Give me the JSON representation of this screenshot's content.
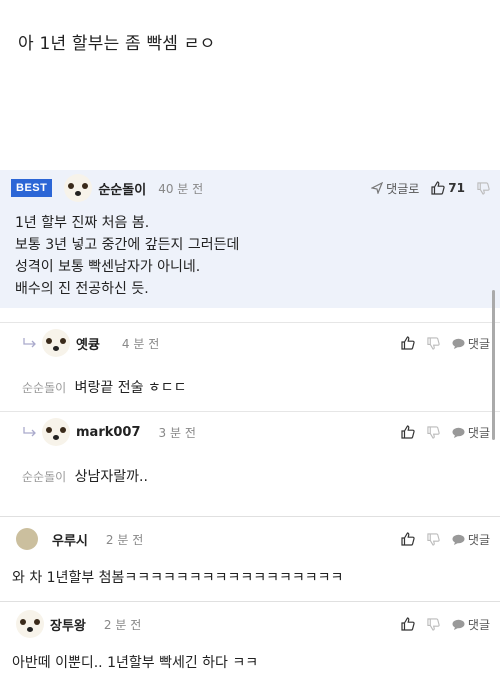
{
  "post": {
    "text": "아 1년 할부는 좀 빡셈 ㄹㅇ"
  },
  "best_comment": {
    "badge": "BEST",
    "nickname": "순순돌이",
    "time": "40 분 전",
    "reply_label": "댓글로",
    "like_count": "71",
    "lines": [
      "1년 할부 진짜 처음 봄.",
      "보통 3년 넣고 중간에 갚든지 그러든데",
      "성격이 보통 빡센남자가 아니네.",
      "배수의 진 전공하신 듯."
    ]
  },
  "replies": [
    {
      "nickname": "옛큥",
      "time": "4 분 전",
      "to": "순순돌이",
      "text": "벼랑끝 전술 ㅎㄷㄷ",
      "reply_label": "댓글"
    },
    {
      "nickname": "mark007",
      "time": "3 분 전",
      "to": "순순돌이",
      "text": "상남자랄까..",
      "reply_label": "댓글"
    }
  ],
  "comments": [
    {
      "nickname": "우루시",
      "time": "2 분 전",
      "text": "와 차 1년할부 첨봄ㅋㅋㅋㅋㅋㅋㅋㅋㅋㅋㅋㅋㅋㅋㅋㅋㅋ",
      "reply_label": "댓글",
      "avatar": "tan"
    },
    {
      "nickname": "장투왕",
      "time": "2 분 전",
      "text": "아반떼 이뿐디.. 1년할부 빡세긴 하다 ㅋㅋ",
      "reply_label": "댓글",
      "avatar": "dog"
    }
  ],
  "icons": [
    "thumbs-up-icon",
    "thumbs-down-icon",
    "speech-bubble-icon",
    "send-icon",
    "reply-arrow-icon"
  ],
  "colors": {
    "best_badge": "#2c66d6",
    "best_background": "#eef2fa"
  }
}
